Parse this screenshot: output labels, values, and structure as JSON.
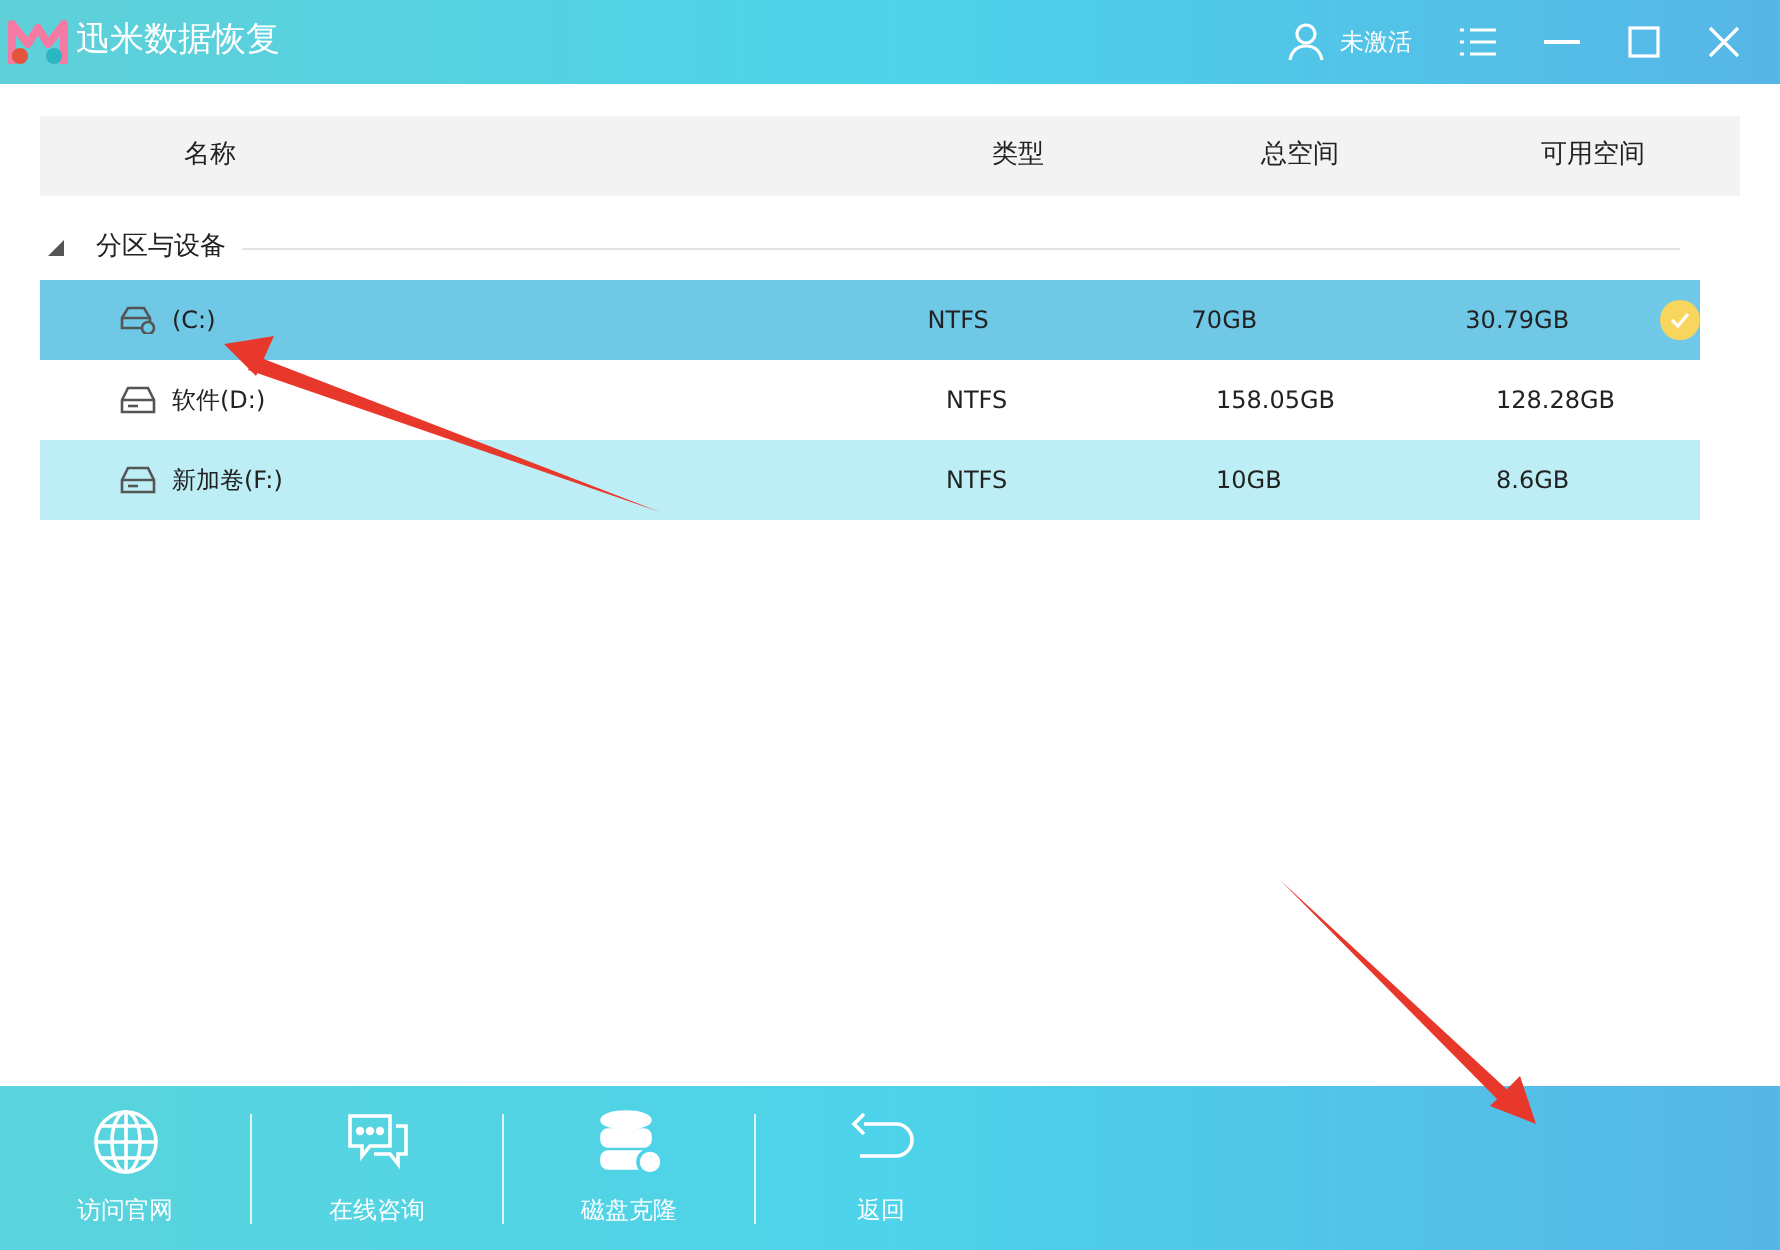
{
  "window": {
    "title": "迅米数据恢复",
    "account": "未激活"
  },
  "table": {
    "columns": [
      "名称",
      "类型",
      "总空间",
      "可用空间"
    ],
    "group": {
      "label": "分区与设备",
      "expanded": true
    },
    "rows": [
      {
        "name": "(C:)",
        "type": "NTFS",
        "total": "70GB",
        "free": "30.79GB",
        "selected": true,
        "kind": "system"
      },
      {
        "name": "软件(D:)",
        "type": "NTFS",
        "total": "158.05GB",
        "free": "128.28GB",
        "selected": false,
        "kind": "disk"
      },
      {
        "name": "新加卷(F:)",
        "type": "NTFS",
        "total": "10GB",
        "free": "8.6GB",
        "selected": false,
        "kind": "disk"
      }
    ]
  },
  "toolbar": [
    {
      "label": "访问官网",
      "kind": "globe"
    },
    {
      "label": "在线咨询",
      "kind": "chat"
    },
    {
      "label": "磁盘克隆",
      "kind": "database"
    },
    {
      "label": "返回",
      "kind": "back"
    }
  ]
}
